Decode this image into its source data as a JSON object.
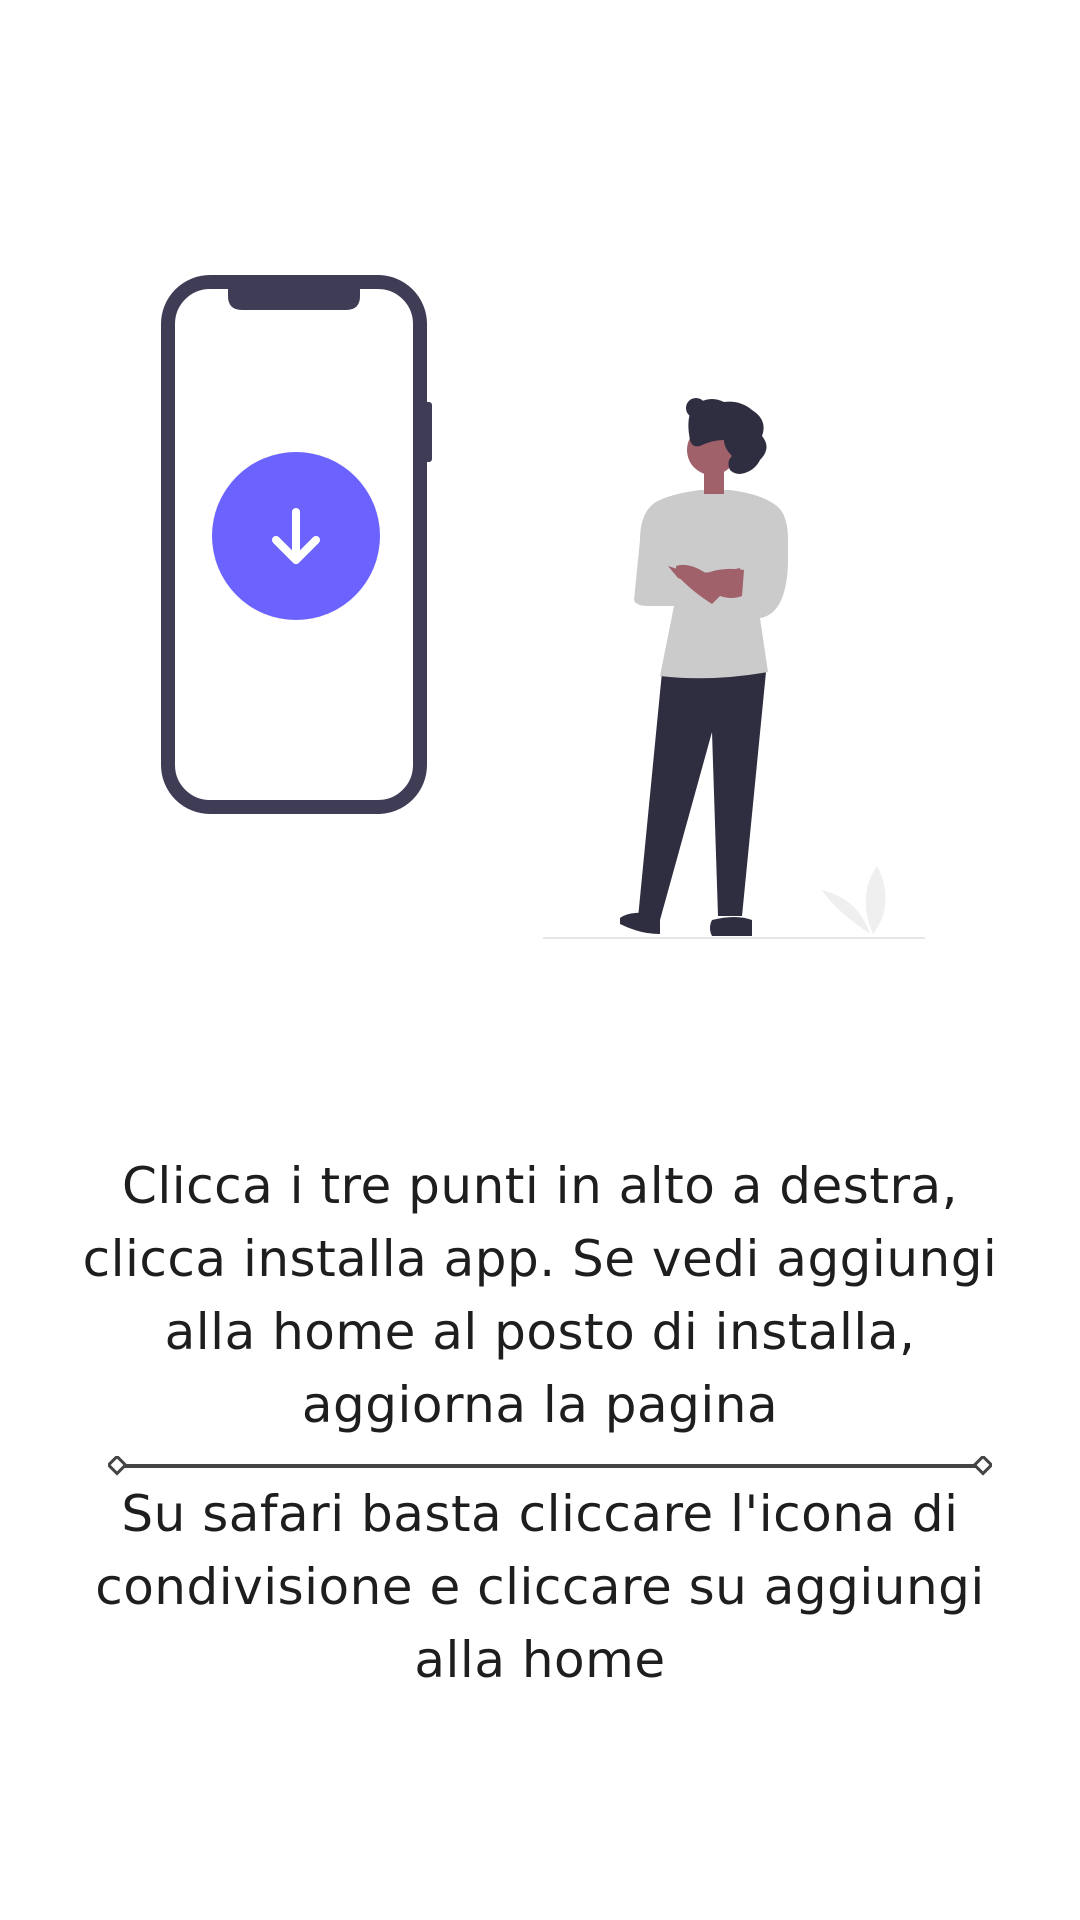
{
  "illustration": {
    "alt": "download-app",
    "colors": {
      "phone_frame": "#3f3d56",
      "download_button": "#6c63ff",
      "arrow": "#ffffff",
      "person_hair": "#2f2e41",
      "person_skin": "#a0616a",
      "person_shirt": "#cbcbcb",
      "person_pants": "#2f2e41",
      "ground": "#e6e6e6"
    },
    "icons": {
      "download": "down-arrow-icon",
      "phone": "smartphone-icon"
    }
  },
  "instructions": {
    "android": "Clicca i tre punti in alto a destra, clicca installa app. Se vedi aggiungi alla home al posto di installa, aggiorna la pagina",
    "safari": "Su safari basta cliccare l'icona di condivisione e cliccare su aggiungi alla home"
  },
  "divider": {
    "color": "#444444"
  }
}
